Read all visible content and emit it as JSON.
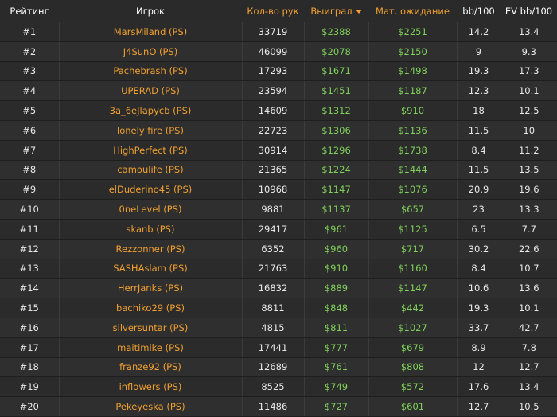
{
  "headers": {
    "rank": "Рейтинг",
    "player": "Игрок",
    "hands": "Кол-во рук",
    "won": "Выиграл",
    "ev": "Мат. ожидание",
    "bb100": "bb/100",
    "evbb100": "EV bb/100"
  },
  "colors": {
    "accent": "#f0a030",
    "money": "#7fd05a",
    "background": "#2a2a2a"
  },
  "rows": [
    {
      "rank": "#1",
      "player": "MarsMiland (PS)",
      "hands": "33719",
      "won": "$2388",
      "ev": "$2251",
      "bb100": "14.2",
      "evbb100": "13.4"
    },
    {
      "rank": "#2",
      "player": "J4SunO (PS)",
      "hands": "46099",
      "won": "$2078",
      "ev": "$2150",
      "bb100": "9",
      "evbb100": "9.3"
    },
    {
      "rank": "#3",
      "player": "Pachebrash (PS)",
      "hands": "17293",
      "won": "$1671",
      "ev": "$1498",
      "bb100": "19.3",
      "evbb100": "17.3"
    },
    {
      "rank": "#4",
      "player": "UPERAD (PS)",
      "hands": "23594",
      "won": "$1451",
      "ev": "$1187",
      "bb100": "12.3",
      "evbb100": "10.1"
    },
    {
      "rank": "#5",
      "player": "3a_6eJlapycb (PS)",
      "hands": "14609",
      "won": "$1312",
      "ev": "$910",
      "bb100": "18",
      "evbb100": "12.5"
    },
    {
      "rank": "#6",
      "player": "lonely fire (PS)",
      "hands": "22723",
      "won": "$1306",
      "ev": "$1136",
      "bb100": "11.5",
      "evbb100": "10"
    },
    {
      "rank": "#7",
      "player": "HighPerfect (PS)",
      "hands": "30914",
      "won": "$1296",
      "ev": "$1738",
      "bb100": "8.4",
      "evbb100": "11.2"
    },
    {
      "rank": "#8",
      "player": "camoulife (PS)",
      "hands": "21365",
      "won": "$1224",
      "ev": "$1444",
      "bb100": "11.5",
      "evbb100": "13.5"
    },
    {
      "rank": "#9",
      "player": "elDuderino45 (PS)",
      "hands": "10968",
      "won": "$1147",
      "ev": "$1076",
      "bb100": "20.9",
      "evbb100": "19.6"
    },
    {
      "rank": "#10",
      "player": "0neLevel (PS)",
      "hands": "9881",
      "won": "$1137",
      "ev": "$657",
      "bb100": "23",
      "evbb100": "13.3"
    },
    {
      "rank": "#11",
      "player": "skanb (PS)",
      "hands": "29417",
      "won": "$961",
      "ev": "$1125",
      "bb100": "6.5",
      "evbb100": "7.7"
    },
    {
      "rank": "#12",
      "player": "Rezzonner (PS)",
      "hands": "6352",
      "won": "$960",
      "ev": "$717",
      "bb100": "30.2",
      "evbb100": "22.6"
    },
    {
      "rank": "#13",
      "player": "SASHAslam (PS)",
      "hands": "21763",
      "won": "$910",
      "ev": "$1160",
      "bb100": "8.4",
      "evbb100": "10.7"
    },
    {
      "rank": "#14",
      "player": "HerrJanks (PS)",
      "hands": "16832",
      "won": "$889",
      "ev": "$1147",
      "bb100": "10.6",
      "evbb100": "13.6"
    },
    {
      "rank": "#15",
      "player": "bachiko29 (PS)",
      "hands": "8811",
      "won": "$848",
      "ev": "$442",
      "bb100": "19.3",
      "evbb100": "10.1"
    },
    {
      "rank": "#16",
      "player": "silversuntar (PS)",
      "hands": "4815",
      "won": "$811",
      "ev": "$1027",
      "bb100": "33.7",
      "evbb100": "42.7"
    },
    {
      "rank": "#17",
      "player": "maitimike (PS)",
      "hands": "17441",
      "won": "$777",
      "ev": "$679",
      "bb100": "8.9",
      "evbb100": "7.8"
    },
    {
      "rank": "#18",
      "player": "franze92 (PS)",
      "hands": "12689",
      "won": "$761",
      "ev": "$808",
      "bb100": "12",
      "evbb100": "12.7"
    },
    {
      "rank": "#19",
      "player": "inflowers (PS)",
      "hands": "8525",
      "won": "$749",
      "ev": "$572",
      "bb100": "17.6",
      "evbb100": "13.4"
    },
    {
      "rank": "#20",
      "player": "Pekeyeska (PS)",
      "hands": "11486",
      "won": "$727",
      "ev": "$601",
      "bb100": "12.7",
      "evbb100": "10.5"
    }
  ]
}
